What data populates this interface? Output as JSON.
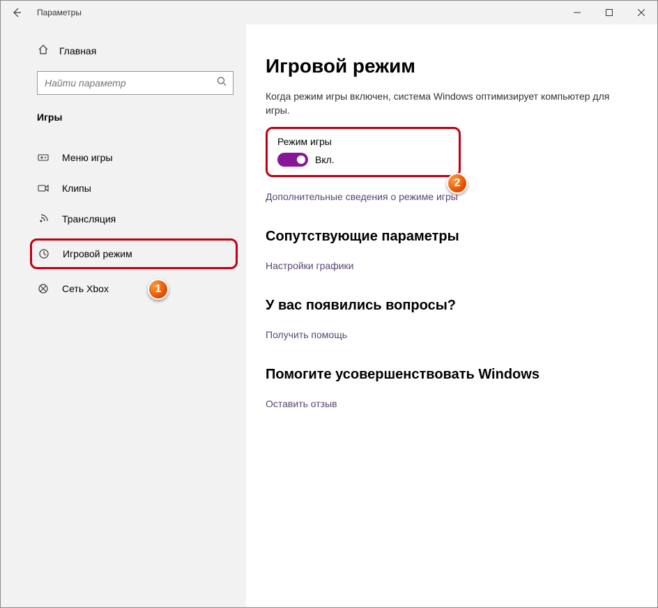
{
  "window": {
    "title": "Параметры"
  },
  "sidebar": {
    "home": "Главная",
    "search_placeholder": "Найти параметр",
    "section": "Игры",
    "items": [
      {
        "label": "Меню игры"
      },
      {
        "label": "Клипы"
      },
      {
        "label": "Трансляция"
      },
      {
        "label": "Игровой режим"
      },
      {
        "label": "Сеть Xbox"
      }
    ]
  },
  "main": {
    "heading": "Игровой режим",
    "description": "Когда режим игры включен, система Windows оптимизирует компьютер для игры.",
    "toggle_label": "Режим игры",
    "toggle_state": "Вкл.",
    "learn_more": "Дополнительные сведения о режиме игры",
    "related_heading": "Сопутствующие параметры",
    "related_link": "Настройки графики",
    "questions_heading": "У вас появились вопросы?",
    "questions_link": "Получить помощь",
    "feedback_heading": "Помогите усовершенствовать Windows",
    "feedback_link": "Оставить отзыв"
  },
  "annotations": {
    "badge1": "1",
    "badge2": "2"
  }
}
